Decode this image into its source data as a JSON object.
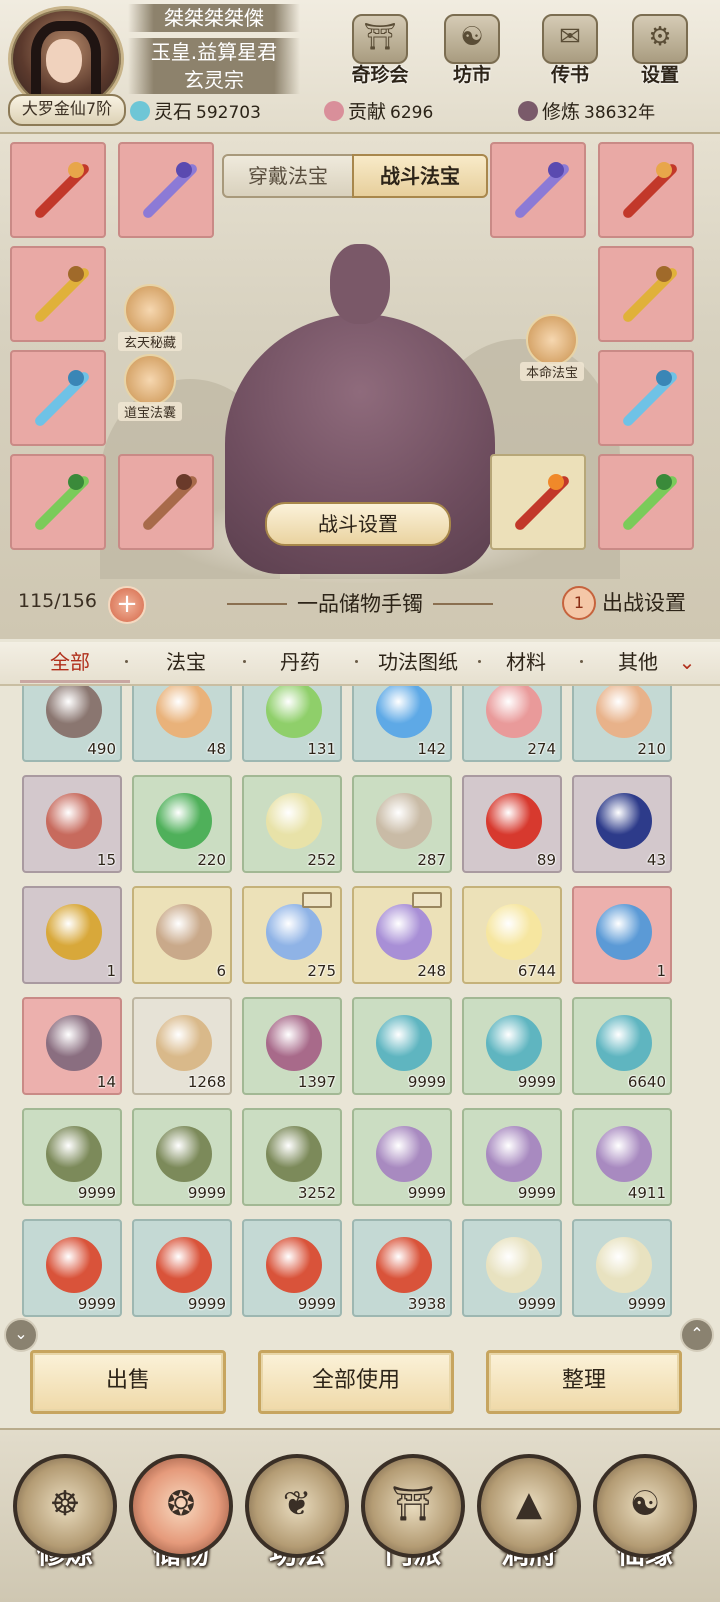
{
  "header": {
    "player_name": "桀桀桀桀傑",
    "title": "玉皇.益算星君",
    "sect": "玄灵宗",
    "realm": "大罗金仙7阶",
    "buttons": [
      {
        "label": "奇珍会",
        "icon": "treasure-pavilion-icon",
        "glyph": "⛩"
      },
      {
        "label": "坊市",
        "icon": "market-icon",
        "glyph": "☯"
      },
      {
        "label": "传书",
        "icon": "scroll-message-icon",
        "glyph": "✉"
      },
      {
        "label": "设置",
        "icon": "gear-icon",
        "glyph": "⚙"
      }
    ],
    "resources": [
      {
        "label": "灵石",
        "value": "592703",
        "icon": "spirit-stone-icon",
        "color": "#6ec6d6"
      },
      {
        "label": "贡献",
        "value": "6296",
        "icon": "contribution-icon",
        "color": "#d98f9a"
      },
      {
        "label": "修炼",
        "value": "38632年",
        "icon": "cultivation-icon",
        "color": "#7a5a6a"
      }
    ]
  },
  "equipment": {
    "tabs": [
      "穿戴法宝",
      "战斗法宝"
    ],
    "active_tab": "战斗法宝",
    "left_side_buttons": [
      {
        "label": "玄天秘藏",
        "icon": "mystic-vault-icon"
      },
      {
        "label": "道宝法囊",
        "icon": "treasure-pouch-icon"
      }
    ],
    "right_side_button": {
      "label": "本命法宝",
      "icon": "natal-treasure-icon"
    },
    "battle_settings": "战斗设置",
    "capacity": "115/156",
    "bag_name": "一品储物手镯",
    "deploy_count": "1",
    "deploy_label": "出战设置"
  },
  "categories": [
    "全部",
    "法宝",
    "丹药",
    "功法图纸",
    "材料",
    "其他"
  ],
  "active_category": "全部",
  "items": [
    {
      "qty": "490",
      "quality": "teal",
      "color": "#8a7670"
    },
    {
      "qty": "48",
      "quality": "teal",
      "color": "#e9b27a"
    },
    {
      "qty": "131",
      "quality": "teal",
      "color": "#8fcf6a"
    },
    {
      "qty": "142",
      "quality": "teal",
      "color": "#5ea9e6"
    },
    {
      "qty": "274",
      "quality": "teal",
      "color": "#e99a9a"
    },
    {
      "qty": "210",
      "quality": "teal",
      "color": "#e8b28a"
    },
    {
      "qty": "15",
      "quality": "purple",
      "color": "#c76a5d"
    },
    {
      "qty": "220",
      "quality": "green",
      "color": "#4fb05a"
    },
    {
      "qty": "252",
      "quality": "green",
      "color": "#e8e2a8"
    },
    {
      "qty": "287",
      "quality": "green",
      "color": "#c9bba6"
    },
    {
      "qty": "89",
      "quality": "purple",
      "color": "#d7392e"
    },
    {
      "qty": "43",
      "quality": "purple",
      "color": "#2d3b8a"
    },
    {
      "qty": "1",
      "quality": "purple",
      "color": "#d8a83a"
    },
    {
      "qty": "6",
      "quality": "gold",
      "color": "#c9a98a"
    },
    {
      "qty": "275",
      "quality": "gold",
      "color": "#8fb3e6",
      "tag": true
    },
    {
      "qty": "248",
      "quality": "gold",
      "color": "#a88fd6",
      "tag": true
    },
    {
      "qty": "6744",
      "quality": "gold",
      "color": "#f6e6a0"
    },
    {
      "qty": "1",
      "quality": "red",
      "color": "#5b9ad6"
    },
    {
      "qty": "14",
      "quality": "red",
      "color": "#8a6e80"
    },
    {
      "qty": "1268",
      "quality": "white",
      "color": "#d9b98a"
    },
    {
      "qty": "1397",
      "quality": "green",
      "color": "#a86a8a"
    },
    {
      "qty": "9999",
      "quality": "green",
      "color": "#5fb5c0"
    },
    {
      "qty": "9999",
      "quality": "green",
      "color": "#5fb5c0"
    },
    {
      "qty": "6640",
      "quality": "green",
      "color": "#5fb5c0"
    },
    {
      "qty": "9999",
      "quality": "green",
      "color": "#7c8a5a"
    },
    {
      "qty": "9999",
      "quality": "green",
      "color": "#7c8a5a"
    },
    {
      "qty": "3252",
      "quality": "green",
      "color": "#7c8a5a"
    },
    {
      "qty": "9999",
      "quality": "green",
      "color": "#a88ac0"
    },
    {
      "qty": "9999",
      "quality": "green",
      "color": "#a88ac0"
    },
    {
      "qty": "4911",
      "quality": "green",
      "color": "#a88ac0"
    },
    {
      "qty": "9999",
      "quality": "teal",
      "color": "#d9533a"
    },
    {
      "qty": "9999",
      "quality": "teal",
      "color": "#d9533a"
    },
    {
      "qty": "9999",
      "quality": "teal",
      "color": "#d9533a"
    },
    {
      "qty": "3938",
      "quality": "teal",
      "color": "#d9533a"
    },
    {
      "qty": "9999",
      "quality": "teal",
      "color": "#e8e2c0"
    },
    {
      "qty": "9999",
      "quality": "teal",
      "color": "#e8e2c0"
    }
  ],
  "actions": [
    "出售",
    "全部使用",
    "整理"
  ],
  "nav": [
    {
      "label": "修炼",
      "icon": "cultivation-nav-icon",
      "glyph": "☸"
    },
    {
      "label": "储物",
      "icon": "storage-bag-icon",
      "glyph": "❂"
    },
    {
      "label": "功法",
      "icon": "technique-scroll-icon",
      "glyph": "❦"
    },
    {
      "label": "门派",
      "icon": "sect-gate-icon",
      "glyph": "⛩"
    },
    {
      "label": "洞府",
      "icon": "cave-dwelling-icon",
      "glyph": "▲"
    },
    {
      "label": "仙缘",
      "icon": "immortal-fate-icon",
      "glyph": "☯"
    }
  ],
  "active_nav": "储物"
}
